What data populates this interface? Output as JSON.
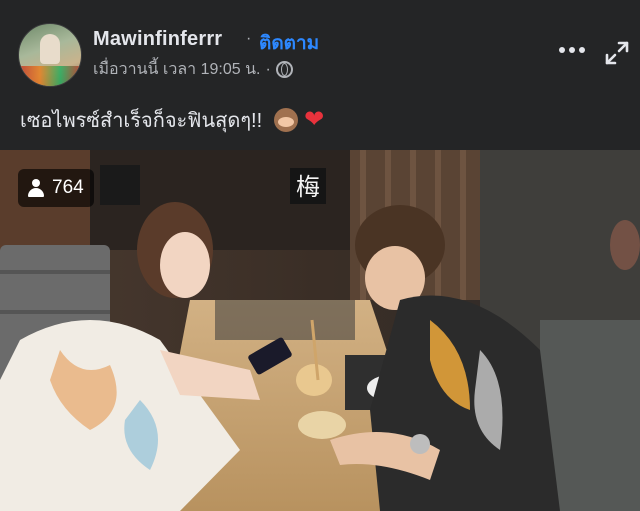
{
  "post": {
    "author": "Mawinfinferrr",
    "separator": "·",
    "follow_label": "ติดตาม",
    "timestamp": "เมื่อวานนี้ เวลา 19:05 น.",
    "meta_separator": "·",
    "audience_icon": "globe-icon",
    "caption": "เซอไพรซ์สำเร็จก็จะฟินสุดๆ!!",
    "caption_emojis": [
      "see-no-evil-monkey-icon",
      "red-heart-icon"
    ]
  },
  "header_actions": {
    "more_icon": "more-horizontal-icon",
    "expand_icon": "expand-icon"
  },
  "video": {
    "views": "764",
    "views_icon": "person-icon",
    "sign_text": "梅"
  },
  "colors": {
    "background": "#242526",
    "text_primary": "#e4e6eb",
    "text_secondary": "#b0b3b8",
    "link_blue": "#2d88ff",
    "heart_red": "#e8323c"
  }
}
